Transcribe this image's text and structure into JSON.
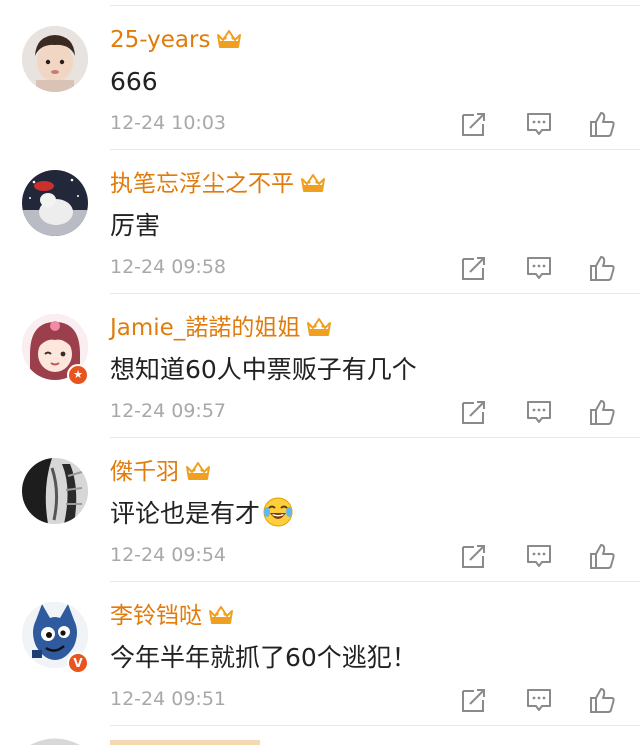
{
  "comments": [
    {
      "username": "25-years",
      "text": "666",
      "time": "12-24 10:03",
      "badge": ""
    },
    {
      "username": "执笔忘浮尘之不平",
      "text": "厉害",
      "time": "12-24 09:58",
      "badge": ""
    },
    {
      "username": "Jamie_諾諾的姐姐",
      "text": "想知道60人中票贩子有几个",
      "time": "12-24 09:57",
      "badge": "star"
    },
    {
      "username": "傑千羽",
      "text": "评论也是有才",
      "time": "12-24 09:54",
      "badge": "",
      "emoji": "laughing-crying-emoji"
    },
    {
      "username": "李铃铛哒",
      "text": "今年半年就抓了60个逃犯！",
      "time": "12-24 09:51",
      "badge": "V"
    }
  ],
  "icons": {
    "member": "crown-icon",
    "share": "share-icon",
    "reply": "comment-icon",
    "like": "thumbs-up-icon"
  },
  "colors": {
    "username": "#e07b0c",
    "crown": "#f0a020",
    "text": "#222222",
    "timestamp": "#a8a8a8",
    "icon": "#8a8a8a",
    "verified_badge": "#e8541e"
  }
}
